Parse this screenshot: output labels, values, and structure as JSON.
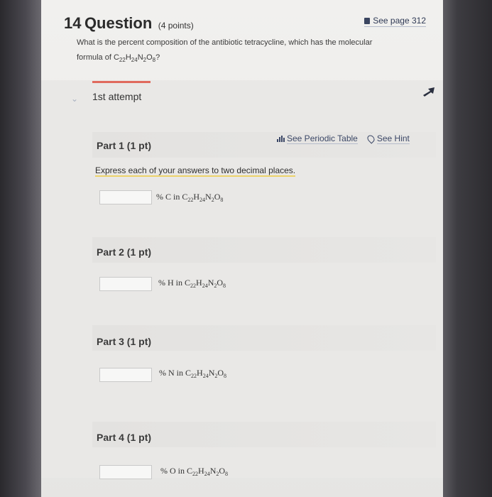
{
  "question": {
    "number": "14",
    "title_word": "Question",
    "points": "(4 points)",
    "see_page": "See page 312",
    "text_line1": "What is the percent composition of the antibiotic tetracycline, which has the molecular",
    "text_line2_prefix": "formula of ",
    "formula": {
      "C": "22",
      "H": "24",
      "N": "2",
      "O": "8"
    },
    "text_line2_suffix": "?"
  },
  "attempt": {
    "label": "1st attempt",
    "accent_color": "#e06a5d"
  },
  "tools": {
    "periodic_table": "See Periodic Table",
    "hint": "See Hint"
  },
  "instruction": "Express each of your answers to two decimal places.",
  "parts": [
    {
      "title": "Part 1 (1 pt)",
      "element": "C",
      "input_value": ""
    },
    {
      "title": "Part 2 (1 pt)",
      "element": "H",
      "input_value": ""
    },
    {
      "title": "Part 3 (1 pt)",
      "element": "N",
      "input_value": ""
    },
    {
      "title": "Part 4 (1 pt)",
      "element": "O",
      "input_value": ""
    }
  ],
  "label_prefix": "% ",
  "label_mid": " in C",
  "icons": [
    "book-icon",
    "chevron-down-icon",
    "arrow-icon",
    "table-icon",
    "hint-icon"
  ]
}
